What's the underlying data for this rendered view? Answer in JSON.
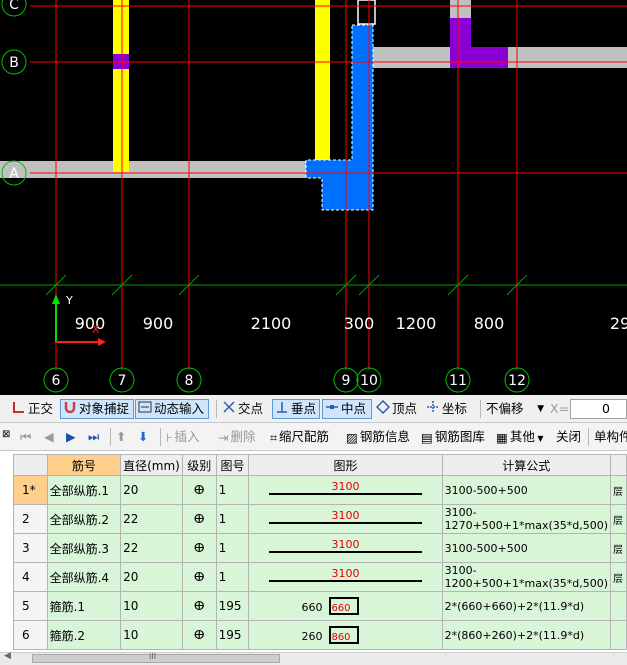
{
  "cad": {
    "axes_bottom": [
      "6",
      "7",
      "8",
      "9",
      "10",
      "11",
      "12"
    ],
    "axes_left": [
      "C",
      "B",
      "A"
    ],
    "dims": [
      "900",
      "900",
      "2100",
      "300",
      "1200",
      "800",
      "29"
    ],
    "ucs": {
      "y": "Y",
      "x": "X"
    }
  },
  "toolbar1": {
    "ortho": "正交",
    "snap": "对象捕捉",
    "dyn": "动态输入",
    "intersect": "交点",
    "perp": "垂点",
    "mid": "中点",
    "vertex": "顶点",
    "coord": "坐标",
    "offset": "不偏移",
    "x_label": "X=",
    "x_value": "0"
  },
  "toolbar2": {
    "insert": "插入",
    "delete": "删除",
    "scale": "缩尺配筋",
    "info": "钢筋信息",
    "lib": "钢筋图库",
    "other": "其他",
    "close": "关闭",
    "unit": "单构件"
  },
  "table": {
    "headers": [
      "筋号",
      "直径(mm)",
      "级别",
      "图号",
      "图形",
      "计算公式"
    ],
    "rows": [
      {
        "no": "1*",
        "name": "全部纵筋.1",
        "dia": "20",
        "grade": "ⴲ",
        "fig": "1",
        "len": "3100",
        "formula": "3100-500+500",
        "rest": "层"
      },
      {
        "no": "2",
        "name": "全部纵筋.2",
        "dia": "22",
        "grade": "ⴲ",
        "fig": "1",
        "len": "3100",
        "formula": "3100-1270+500+1*max(35*d,500)",
        "rest": "层"
      },
      {
        "no": "3",
        "name": "全部纵筋.3",
        "dia": "22",
        "grade": "ⴲ",
        "fig": "1",
        "len": "3100",
        "formula": "3100-500+500",
        "rest": "层"
      },
      {
        "no": "4",
        "name": "全部纵筋.4",
        "dia": "20",
        "grade": "ⴲ",
        "fig": "1",
        "len": "3100",
        "formula": "3100-1200+500+1*max(35*d,500)",
        "rest": "层"
      },
      {
        "no": "5",
        "name": "箍筋.1",
        "dia": "10",
        "grade": "ⴲ",
        "fig": "195",
        "w": "660",
        "h": "660",
        "formula": "2*(660+660)+2*(11.9*d)",
        "rest": ""
      },
      {
        "no": "6",
        "name": "箍筋.2",
        "dia": "10",
        "grade": "ⴲ",
        "fig": "195",
        "w": "260",
        "h": "860",
        "formula": "2*(860+260)+2*(11.9*d)",
        "rest": ""
      }
    ]
  },
  "colors": {
    "cad_bg": "#000000",
    "wall": "#c0c0c0",
    "yellow_col": "#ffff00",
    "purple": "#8a00d4",
    "blue_col": "#0070ff",
    "grid_line": "#ff0000",
    "axis_green": "#00c000",
    "row_green": "#d8f5d8",
    "highlight": "#ffcf8c"
  },
  "scroll": {
    "h_thumb_label": "III"
  }
}
